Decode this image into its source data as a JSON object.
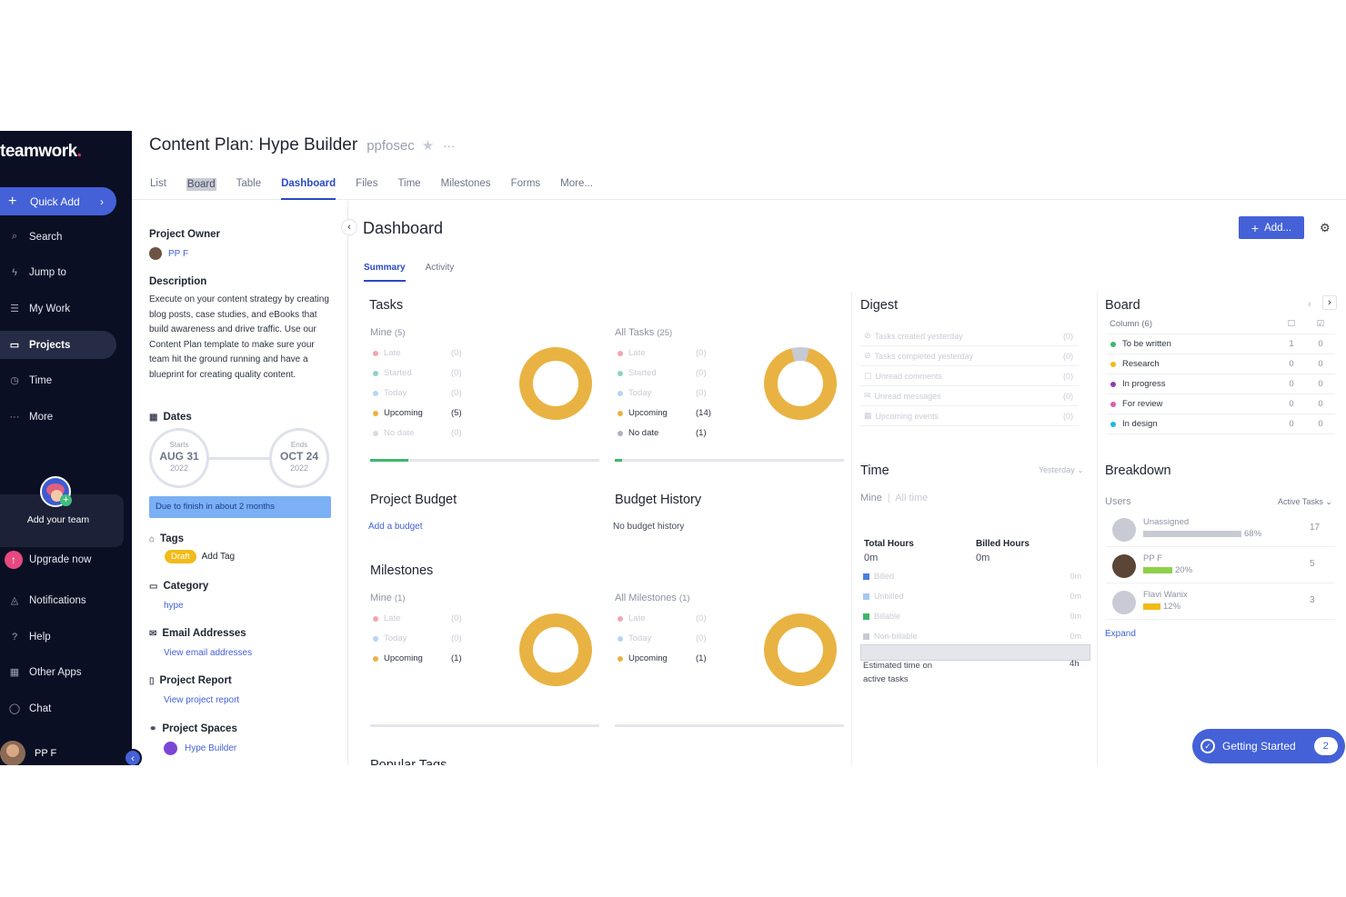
{
  "sidebar": {
    "logo": "teamwork",
    "logo_dot": ".",
    "quick_add": "Quick Add",
    "items": [
      {
        "label": "Search"
      },
      {
        "label": "Jump to"
      },
      {
        "label": "My Work"
      },
      {
        "label": "Projects"
      },
      {
        "label": "Time"
      },
      {
        "label": "More"
      }
    ],
    "add_team": "Add your team",
    "upgrade": "Upgrade now",
    "bottom_items": [
      {
        "label": "Notifications"
      },
      {
        "label": "Help"
      },
      {
        "label": "Other Apps"
      },
      {
        "label": "Chat"
      }
    ],
    "user": "PP F"
  },
  "header": {
    "title": "Content Plan: Hype Builder",
    "subtitle": "ppfosec",
    "tabs": [
      "List",
      "Board",
      "Table",
      "Dashboard",
      "Files",
      "Time",
      "Milestones",
      "Forms",
      "More..."
    ]
  },
  "details": {
    "owner_label": "Project Owner",
    "owner_name": "PP F",
    "description_label": "Description",
    "description": "Execute on your content strategy by creating blog posts, case studies, and eBooks that build awareness and drive traffic. Use our Content Plan template to make sure your team hit the ground running and have a blueprint for creating quality content.",
    "dates_label": "Dates",
    "starts_label": "Starts",
    "starts_date": "AUG 31",
    "starts_year": "2022",
    "ends_label": "Ends",
    "ends_date": "OCT 24",
    "ends_year": "2022",
    "due_text": "Due to finish in about 2 months",
    "tags_label": "Tags",
    "tag_draft": "Draft",
    "add_tag": "Add Tag",
    "category_label": "Category",
    "category_value": "hype",
    "email_label": "Email Addresses",
    "email_link": "View email addresses",
    "report_label": "Project Report",
    "report_link": "View project report",
    "spaces_label": "Project Spaces",
    "space_name": "Hype Builder"
  },
  "dashboard": {
    "title": "Dashboard",
    "add_button": "Add...",
    "subtabs": [
      "Summary",
      "Activity"
    ],
    "tasks": {
      "title": "Tasks",
      "mine_label": "Mine",
      "mine_count": "(5)",
      "all_label": "All Tasks",
      "all_count": "(25)",
      "mine_rows": [
        {
          "label": "Late",
          "count": "(0)"
        },
        {
          "label": "Started",
          "count": "(0)"
        },
        {
          "label": "Today",
          "count": "(0)"
        },
        {
          "label": "Upcoming",
          "count": "(5)"
        },
        {
          "label": "No date",
          "count": "(0)"
        }
      ],
      "all_rows": [
        {
          "label": "Late",
          "count": "(0)"
        },
        {
          "label": "Started",
          "count": "(0)"
        },
        {
          "label": "Today",
          "count": "(0)"
        },
        {
          "label": "Upcoming",
          "count": "(14)"
        },
        {
          "label": "No date",
          "count": "(1)"
        }
      ]
    },
    "project_budget": {
      "title": "Project Budget",
      "link": "Add a budget"
    },
    "budget_history": {
      "title": "Budget History",
      "text": "No budget history"
    },
    "milestones": {
      "title": "Milestones",
      "mine_label": "Mine",
      "mine_count": "(1)",
      "all_label": "All Milestones",
      "all_count": "(1)",
      "mine_rows": [
        {
          "label": "Late",
          "count": "(0)"
        },
        {
          "label": "Today",
          "count": "(0)"
        },
        {
          "label": "Upcoming",
          "count": "(1)"
        }
      ],
      "all_rows": [
        {
          "label": "Late",
          "count": "(0)"
        },
        {
          "label": "Today",
          "count": "(0)"
        },
        {
          "label": "Upcoming",
          "count": "(1)"
        }
      ]
    },
    "popular_tags_title": "Popular Tags",
    "digest": {
      "title": "Digest",
      "rows": [
        {
          "label": "Tasks created yesterday",
          "count": "(0)"
        },
        {
          "label": "Tasks completed yesterday",
          "count": "(0)"
        },
        {
          "label": "Unread comments",
          "count": "(0)"
        },
        {
          "label": "Unread messages",
          "count": "(0)"
        },
        {
          "label": "Upcoming events",
          "count": "(0)"
        }
      ]
    },
    "time": {
      "title": "Time",
      "range": "Yesterday",
      "mine": "Mine",
      "all_time": "All time",
      "total_hours_label": "Total Hours",
      "total_hours": "0m",
      "billed_hours_label": "Billed Hours",
      "billed_hours": "0m",
      "rows": [
        {
          "label": "Billed",
          "value": "0m"
        },
        {
          "label": "Unbilled",
          "value": "0m"
        },
        {
          "label": "Billable",
          "value": "0m"
        },
        {
          "label": "Non-billable",
          "value": "0m"
        }
      ],
      "estimated_label": "Estimated time on active tasks",
      "estimated_value": "4h"
    },
    "board": {
      "title": "Board",
      "column_label": "Column (6)",
      "rows": [
        {
          "label": "To be written",
          "c1": "1",
          "c2": "0"
        },
        {
          "label": "Research",
          "c1": "0",
          "c2": "0"
        },
        {
          "label": "In progress",
          "c1": "0",
          "c2": "0"
        },
        {
          "label": "For review",
          "c1": "0",
          "c2": "0"
        },
        {
          "label": "In design",
          "c1": "0",
          "c2": "0"
        }
      ]
    },
    "breakdown": {
      "title": "Breakdown",
      "users_label": "Users",
      "filter": "Active Tasks",
      "rows": [
        {
          "name": "Unassigned",
          "pct": "68%",
          "num": "17",
          "fraction": 0.68
        },
        {
          "name": "PP F",
          "pct": "20%",
          "num": "5",
          "fraction": 0.2
        },
        {
          "name": "Flavi Wanix",
          "pct": "12%",
          "num": "3",
          "fraction": 0.12
        }
      ],
      "expand": "Expand"
    },
    "getting_started": {
      "label": "Getting Started",
      "count": "2"
    }
  }
}
